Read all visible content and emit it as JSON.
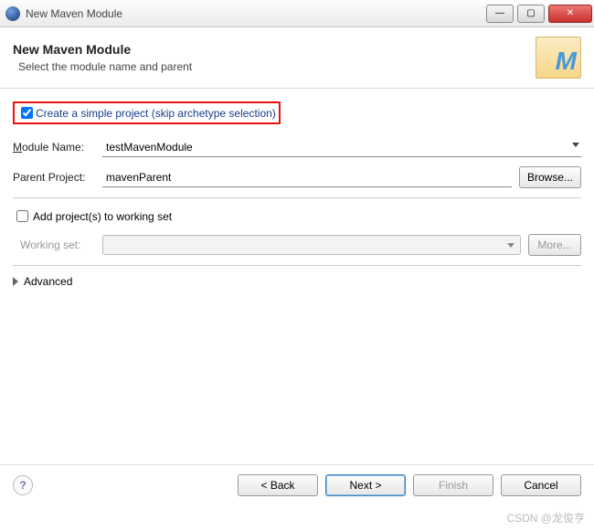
{
  "titlebar": {
    "title": "New Maven Module"
  },
  "header": {
    "title": "New Maven Module",
    "subtitle": "Select the module name and parent"
  },
  "simple_project": {
    "label": "Create a simple project (skip archetype selection)",
    "checked": true
  },
  "module_name": {
    "label": "Module Name:",
    "value": "testMavenModule"
  },
  "parent_project": {
    "label": "Parent Project:",
    "value": "mavenParent"
  },
  "browse_label": "Browse...",
  "add_to_ws": {
    "label": "Add project(s) to working set",
    "checked": false
  },
  "working_set": {
    "label": "Working set:",
    "value": ""
  },
  "more_label": "More...",
  "advanced_label": "Advanced",
  "buttons": {
    "back": "< Back",
    "next": "Next >",
    "finish": "Finish",
    "cancel": "Cancel"
  },
  "watermark": "CSDN @龙俊亨"
}
